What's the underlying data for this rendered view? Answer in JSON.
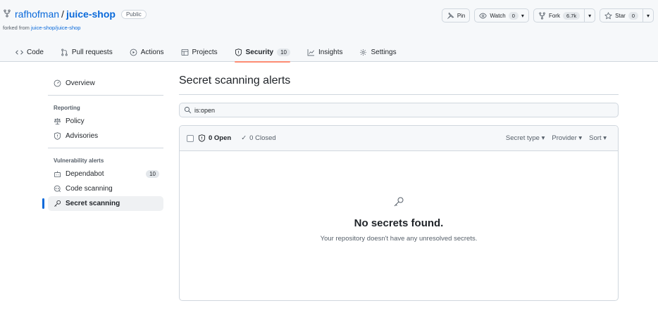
{
  "repo": {
    "owner": "rafhofman",
    "separator": "/",
    "name": "juice-shop",
    "visibility": "Public",
    "forked_prefix": "forked from ",
    "forked_from": "juice-shop/juice-shop"
  },
  "header_actions": {
    "pin": "Pin",
    "watch": "Watch",
    "watch_count": "0",
    "fork": "Fork",
    "fork_count": "6.7k",
    "star": "Star",
    "star_count": "0"
  },
  "tabs": [
    {
      "label": "Code",
      "icon": "code-icon"
    },
    {
      "label": "Pull requests",
      "icon": "pull-request-icon"
    },
    {
      "label": "Actions",
      "icon": "play-icon"
    },
    {
      "label": "Projects",
      "icon": "table-icon"
    },
    {
      "label": "Security",
      "icon": "shield-icon",
      "count": "10",
      "active": true
    },
    {
      "label": "Insights",
      "icon": "graph-icon"
    },
    {
      "label": "Settings",
      "icon": "gear-icon"
    }
  ],
  "sidebar": {
    "overview": "Overview",
    "reporting_heading": "Reporting",
    "policy": "Policy",
    "advisories": "Advisories",
    "vuln_heading": "Vulnerability alerts",
    "dependabot": "Dependabot",
    "dependabot_count": "10",
    "code_scanning": "Code scanning",
    "secret_scanning": "Secret scanning"
  },
  "main": {
    "title": "Secret scanning alerts",
    "search_value": "is:open",
    "open_label": "0 Open",
    "closed_label": "0 Closed",
    "filter_secret_type": "Secret type ▾",
    "filter_provider": "Provider ▾",
    "filter_sort": "Sort ▾",
    "empty_title": "No secrets found.",
    "empty_desc": "Your repository doesn't have any unresolved secrets."
  },
  "colors": {
    "accent_blue": "#0969da",
    "active_tab_underline": "#fd8c73",
    "border": "#d0d7de",
    "header_bg": "#f6f8fa"
  }
}
